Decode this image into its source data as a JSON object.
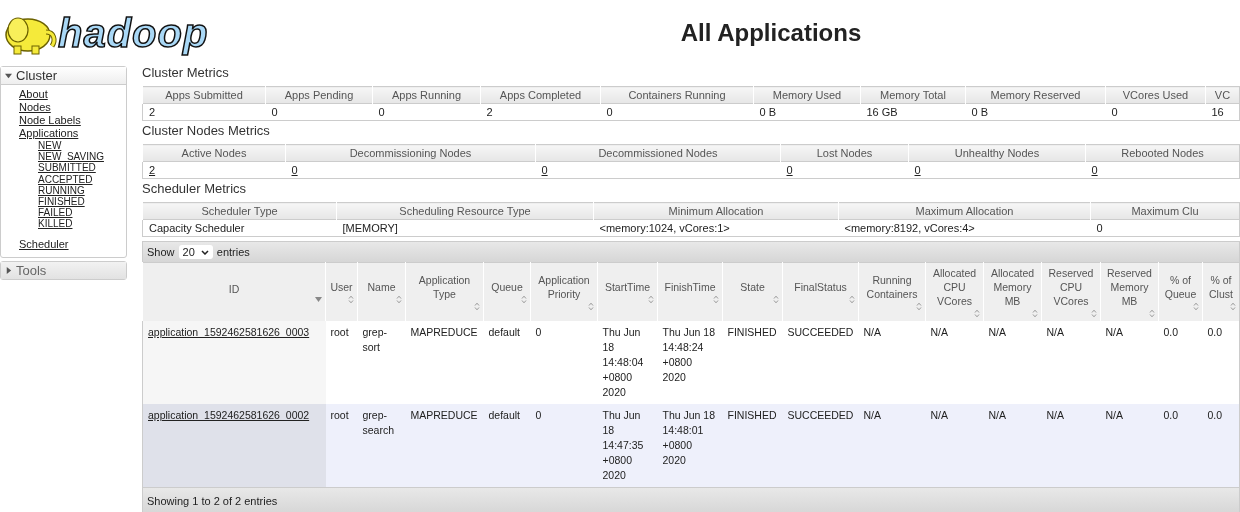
{
  "logo": {
    "text": "hadoop"
  },
  "page_title": "All Applications",
  "sidebar": [
    {
      "label": "Cluster",
      "expanded": true,
      "items": [
        {
          "label": "About"
        },
        {
          "label": "Nodes"
        },
        {
          "label": "Node Labels"
        },
        {
          "label": "Applications",
          "children": [
            {
              "label": "NEW"
            },
            {
              "label": "NEW_SAVING"
            },
            {
              "label": "SUBMITTED"
            },
            {
              "label": "ACCEPTED"
            },
            {
              "label": "RUNNING"
            },
            {
              "label": "FINISHED"
            },
            {
              "label": "FAILED"
            },
            {
              "label": "KILLED"
            }
          ]
        },
        {
          "label": "Scheduler"
        }
      ]
    },
    {
      "label": "Tools",
      "expanded": false
    }
  ],
  "metrics": [
    {
      "title": "Cluster Metrics",
      "values_are_links": false,
      "columns": [
        "Apps Submitted",
        "Apps Pending",
        "Apps Running",
        "Apps Completed",
        "Containers Running",
        "Memory Used",
        "Memory Total",
        "Memory Reserved",
        "VCores Used",
        "VC"
      ],
      "values": [
        "2",
        "0",
        "0",
        "2",
        "0",
        "0 B",
        "16 GB",
        "0 B",
        "0",
        "16"
      ]
    },
    {
      "title": "Cluster Nodes Metrics",
      "values_are_links": true,
      "columns": [
        "Active Nodes",
        "Decommissioning Nodes",
        "Decommissioned Nodes",
        "Lost Nodes",
        "Unhealthy Nodes",
        "Rebooted Nodes"
      ],
      "values": [
        "2",
        "0",
        "0",
        "0",
        "0",
        "0"
      ]
    },
    {
      "title": "Scheduler Metrics",
      "values_are_links": false,
      "columns": [
        "Scheduler Type",
        "Scheduling Resource Type",
        "Minimum Allocation",
        "Maximum Allocation",
        "Maximum Clu"
      ],
      "values": [
        "Capacity Scheduler",
        "[MEMORY]",
        "<memory:1024, vCores:1>",
        "<memory:8192, vCores:4>",
        "0"
      ]
    }
  ],
  "applications": {
    "show_label": "Show",
    "page_size": "20",
    "entries_label": "entries",
    "columns": [
      {
        "label": "ID",
        "sorted": true
      },
      {
        "label": "User",
        "sorted": false
      },
      {
        "label": "Name",
        "sorted": false
      },
      {
        "label": "Application Type",
        "sorted": false
      },
      {
        "label": "Queue",
        "sorted": false
      },
      {
        "label": "Application Priority",
        "sorted": false
      },
      {
        "label": "StartTime",
        "sorted": false
      },
      {
        "label": "FinishTime",
        "sorted": false
      },
      {
        "label": "State",
        "sorted": false
      },
      {
        "label": "FinalStatus",
        "sorted": false
      },
      {
        "label": "Running Containers",
        "sorted": false
      },
      {
        "label": "Allocated CPU VCores",
        "sorted": false
      },
      {
        "label": "Allocated Memory MB",
        "sorted": false
      },
      {
        "label": "Reserved CPU VCores",
        "sorted": false
      },
      {
        "label": "Reserved Memory MB",
        "sorted": false
      },
      {
        "label": "% of Queue",
        "sorted": false
      },
      {
        "label": "% of Clust",
        "sorted": false
      }
    ],
    "rows": [
      {
        "cells": [
          "application_1592462581626_0003",
          "root",
          "grep-sort",
          "MAPREDUCE",
          "default",
          "0",
          "Thu Jun 18 14:48:04 +0800 2020",
          "Thu Jun 18 14:48:24 +0800 2020",
          "FINISHED",
          "SUCCEEDED",
          "N/A",
          "N/A",
          "N/A",
          "N/A",
          "N/A",
          "0.0",
          "0.0"
        ]
      },
      {
        "cells": [
          "application_1592462581626_0002",
          "root",
          "grep-search",
          "MAPREDUCE",
          "default",
          "0",
          "Thu Jun 18 14:47:35 +0800 2020",
          "Thu Jun 18 14:48:01 +0800 2020",
          "FINISHED",
          "SUCCEEDED",
          "N/A",
          "N/A",
          "N/A",
          "N/A",
          "N/A",
          "0.0",
          "0.0"
        ]
      }
    ],
    "footer": "Showing 1 to 2 of 2 entries"
  }
}
